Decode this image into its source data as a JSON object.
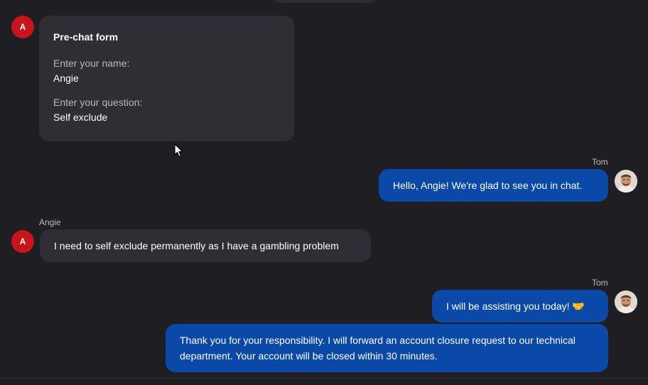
{
  "visitor": {
    "name": "Angie",
    "avatar_initial": "A"
  },
  "agent": {
    "name": "Tom"
  },
  "prechat_form": {
    "title": "Pre-chat form",
    "fields": [
      {
        "label": "Enter your name:",
        "value": "Angie"
      },
      {
        "label": "Enter your question:",
        "value": "Self exclude"
      }
    ]
  },
  "messages": [
    {
      "sender": "Tom",
      "text": "Hello, Angie! We're glad to see you in chat."
    },
    {
      "sender": "Angie",
      "text": "I need to self exclude permanently as I have a gambling problem"
    },
    {
      "sender": "Tom",
      "text": "I will be assisting you today! 🤝"
    },
    {
      "sender": "Tom",
      "text": "Thank you for your responsibility. I will forward an account closure request to our technical department. Your account will be closed within 30 minutes."
    }
  ],
  "colors": {
    "background": "#1f1e22",
    "agent_bubble": "#0a49a8",
    "visitor_bubble": "#2f2e34",
    "visitor_avatar": "#c8141a"
  }
}
